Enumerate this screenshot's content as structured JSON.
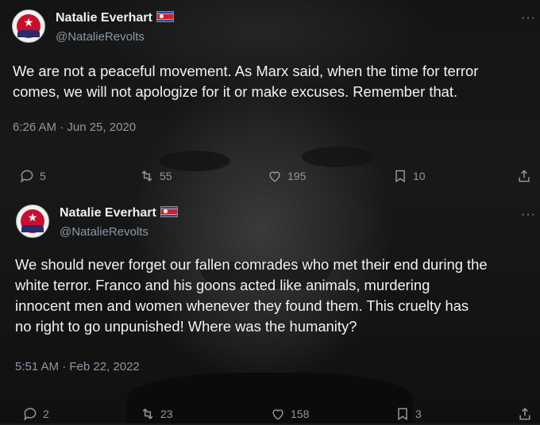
{
  "tweets": [
    {
      "author": "Natalie Everhart",
      "handle": "@NatalieRevolts",
      "text_lines": [
        "We are not a peaceful movement. As Marx said, when the time for terror",
        "comes, we will not apologize for it or make excuses. Remember that."
      ],
      "timestamp": "6:26 AM · Jun 25, 2020",
      "replies": "5",
      "retweets": "55",
      "likes": "195",
      "bookmarks": "10"
    },
    {
      "author": "Natalie Everhart",
      "handle": "@NatalieRevolts",
      "text_lines": [
        "We should never forget our fallen comrades who met their end during the",
        "white terror. Franco and his goons acted like animals, murdering",
        "innocent men and women whenever they found them. This cruelty has",
        "no right to go unpunished! Where was the humanity?"
      ],
      "timestamp": "5:51 AM · Feb 22, 2022",
      "replies": "2",
      "retweets": "23",
      "likes": "158",
      "bookmarks": "3"
    }
  ],
  "more_label": "···",
  "icons": {
    "reply": "reply-icon",
    "retweet": "retweet-icon",
    "like": "heart-icon",
    "bookmark": "bookmark-icon",
    "share": "share-icon",
    "flag": "north-korea-flag-icon"
  },
  "colors": {
    "text": "#e7e9ea",
    "muted": "#8b98a5"
  }
}
